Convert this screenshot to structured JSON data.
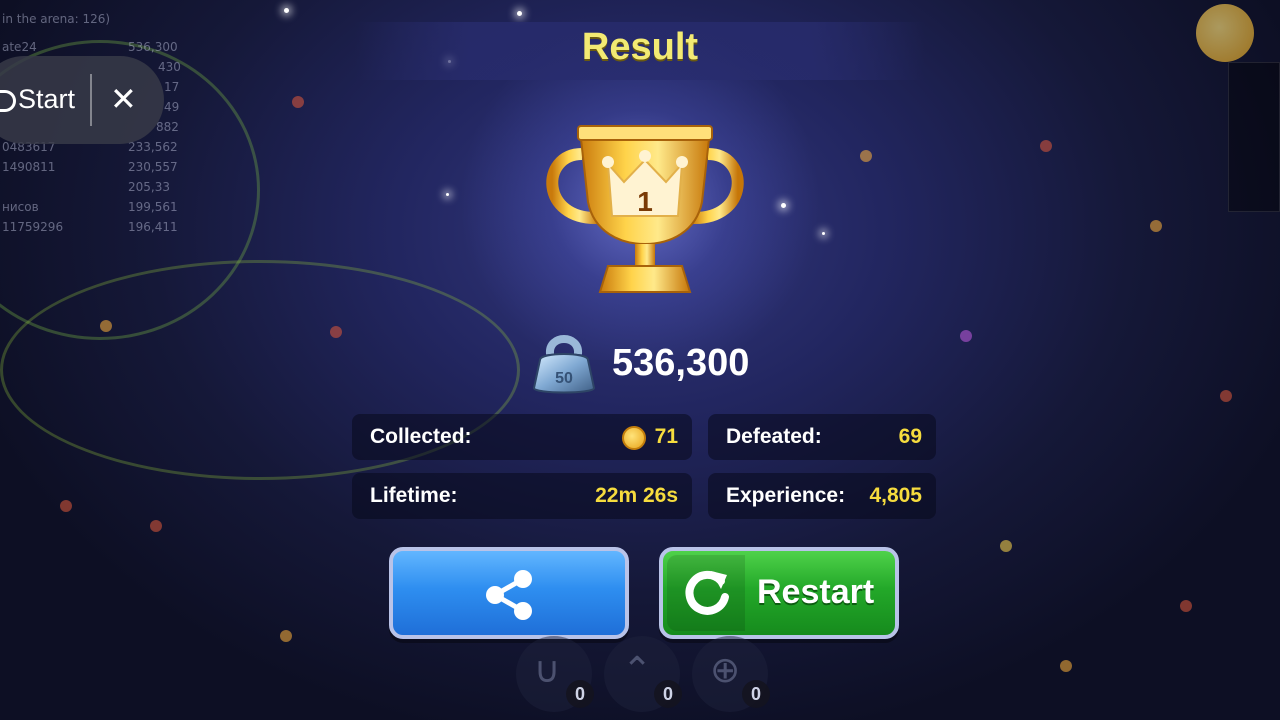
{
  "leaderboard": {
    "header": "in the arena: 126)",
    "rows": [
      {
        "name": "ate24",
        "score": "536,300"
      },
      {
        "name": "",
        "score": "430"
      },
      {
        "name": "",
        "score": "17"
      },
      {
        "name": "",
        "score": "49"
      },
      {
        "name": "",
        "score": "882"
      },
      {
        "name": "0483617",
        "score": "233,562"
      },
      {
        "name": "1490811",
        "score": "230,557"
      },
      {
        "name": "",
        "score": "205,33"
      },
      {
        "name": "нисов",
        "score": "199,561"
      },
      {
        "name": "11759296",
        "score": "196,411"
      }
    ]
  },
  "start_pill": {
    "label": "Start",
    "close_glyph": "✕"
  },
  "result": {
    "title": "Result",
    "trophy_rank": "1",
    "weight_badge": "50",
    "score": "536,300"
  },
  "stats": {
    "collected_label": "Collected:",
    "collected_value": "71",
    "defeated_label": "Defeated:",
    "defeated_value": "69",
    "lifetime_label": "Lifetime:",
    "lifetime_value": "22m 26s",
    "experience_label": "Experience:",
    "experience_value": "4,805"
  },
  "buttons": {
    "restart_label": "Restart"
  },
  "powerups": [
    {
      "icon": "magnet-icon",
      "count": "0"
    },
    {
      "icon": "speed-boost-icon",
      "count": "0"
    },
    {
      "icon": "zoom-icon",
      "count": "0"
    }
  ],
  "colors": {
    "title": "#f3ea73",
    "stat_value": "#f6dc3e",
    "share_button": "#2e8ef0",
    "restart_button": "#23a829"
  }
}
